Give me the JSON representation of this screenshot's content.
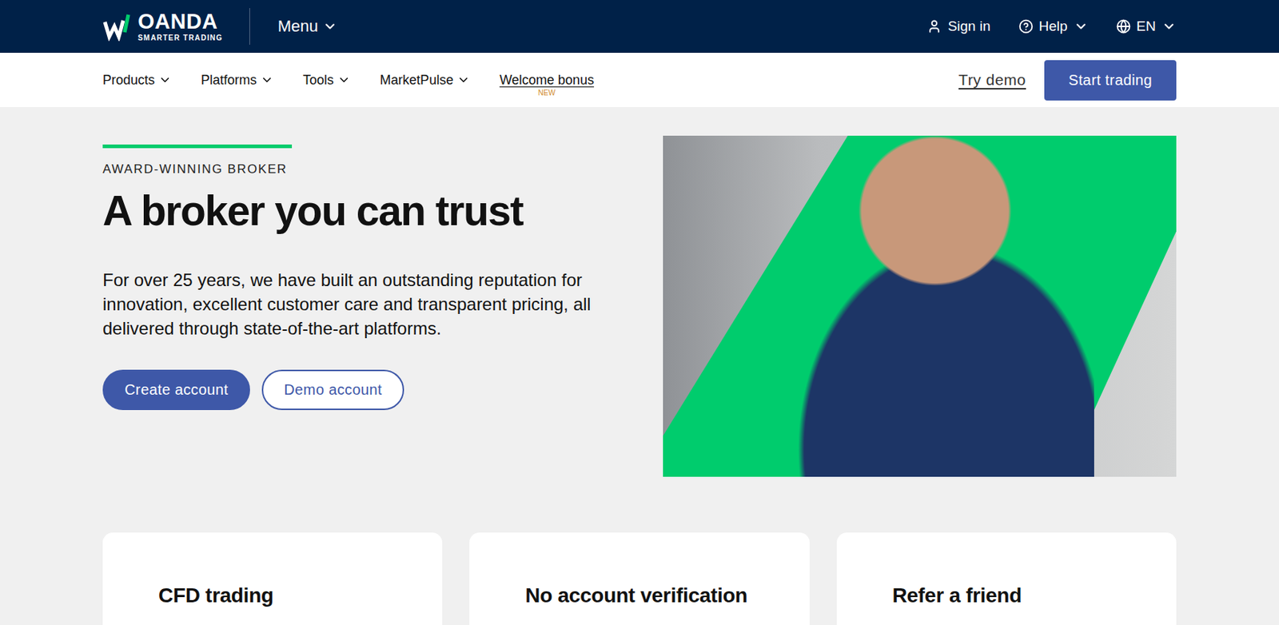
{
  "header": {
    "logo": {
      "name": "OANDA",
      "tagline": "SMARTER TRADING"
    },
    "menu": {
      "label": "Menu"
    },
    "links": [
      {
        "label": "Sign in",
        "kind": "link"
      },
      {
        "label": "Help",
        "kind": "dropdown"
      },
      {
        "label": "EN",
        "kind": "dropdown"
      }
    ]
  },
  "nav": {
    "items": [
      {
        "label": "Products",
        "kind": "dropdown"
      },
      {
        "label": "Platforms",
        "kind": "dropdown"
      },
      {
        "label": "Tools",
        "kind": "dropdown"
      },
      {
        "label": "MarketPulse",
        "kind": "dropdown"
      },
      {
        "label": "Welcome bonus",
        "kind": "link",
        "badge": "NEW"
      }
    ],
    "try_demo": "Try demo",
    "start_trading": "Start trading"
  },
  "hero": {
    "eyebrow": "AWARD-WINNING BROKER",
    "title": "A broker you can trust",
    "body": "For over 25 years, we have built an outstanding reputation for innovation, excellent customer care and transparent pricing, all delivered through state-of-the-art platforms.",
    "buttons": [
      {
        "label": "Create account",
        "kind": "primary"
      },
      {
        "label": "Demo account",
        "kind": "outline"
      }
    ]
  },
  "cards": [
    {
      "title": "CFD trading"
    },
    {
      "title": "No account verification"
    },
    {
      "title": "Refer a friend"
    }
  ]
}
